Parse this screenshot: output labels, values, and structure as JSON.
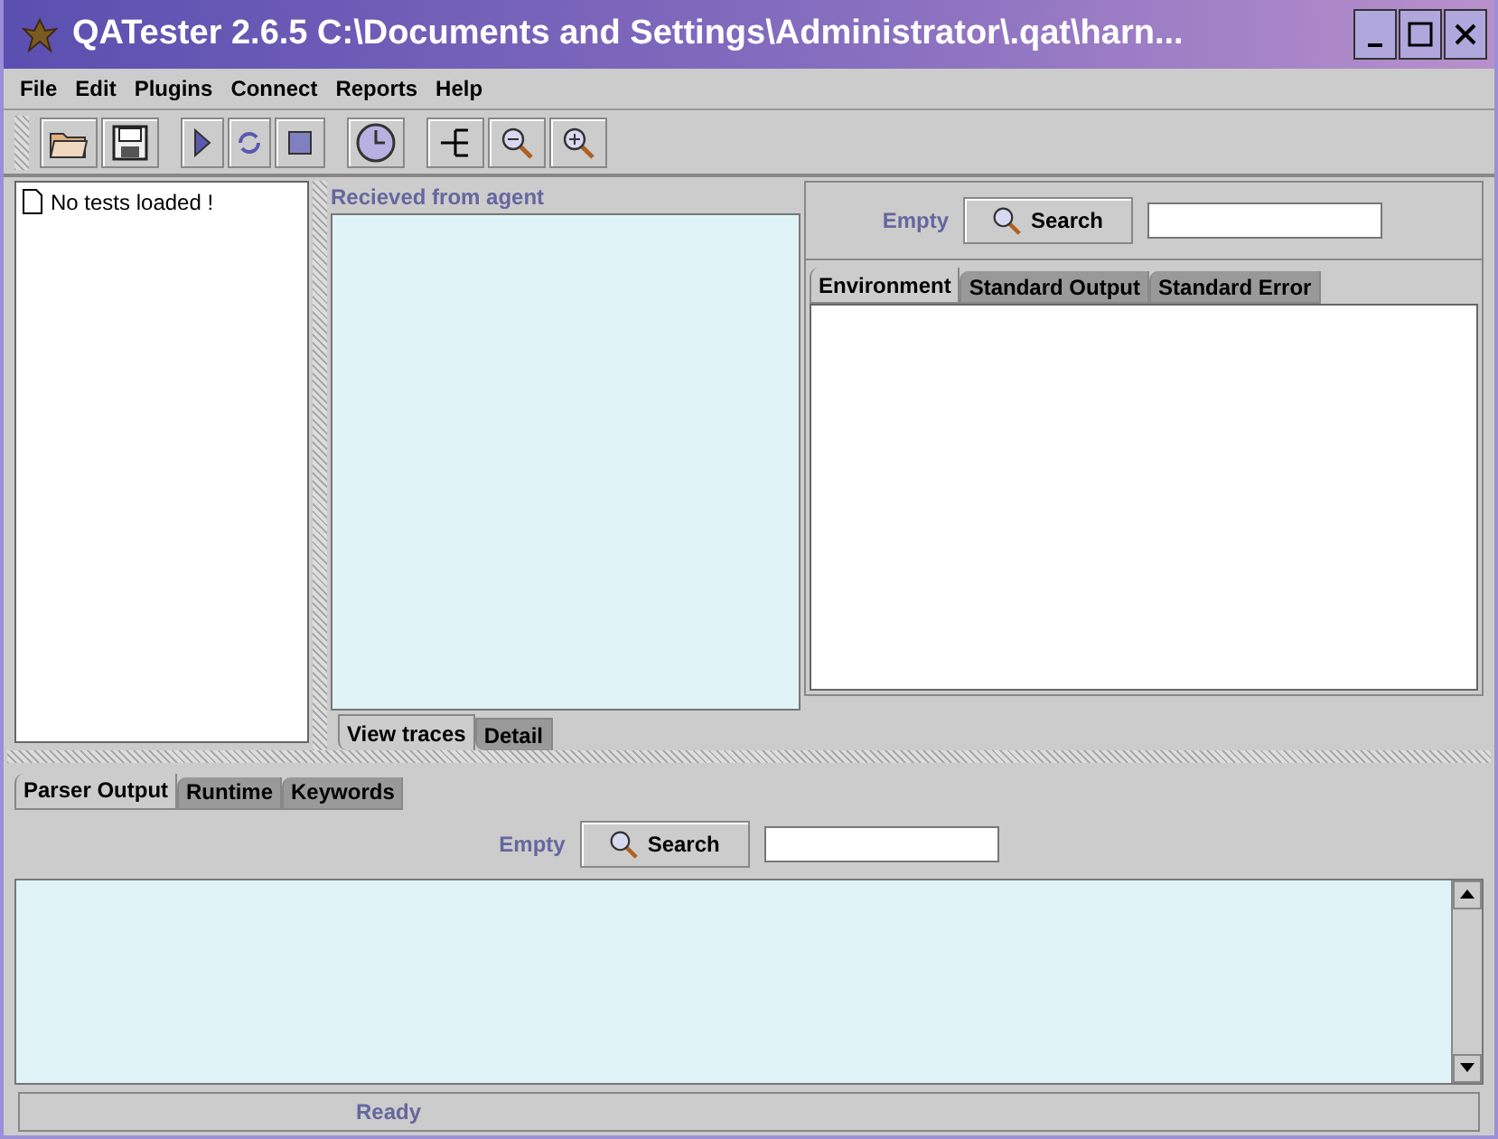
{
  "window": {
    "title": "QATester 2.6.5 C:\\Documents and Settings\\Administrator\\.qat\\harn..."
  },
  "menu": [
    "File",
    "Edit",
    "Plugins",
    "Connect",
    "Reports",
    "Help"
  ],
  "tree": {
    "items": [
      {
        "label": "No tests loaded !"
      }
    ]
  },
  "traces": {
    "heading": "Recieved from agent",
    "tabs": [
      {
        "label": "View traces",
        "selected": true
      },
      {
        "label": "Detail",
        "selected": false
      }
    ]
  },
  "details": {
    "search": {
      "status": "Empty",
      "button": "Search"
    },
    "tabs": [
      {
        "label": "Environment",
        "selected": true
      },
      {
        "label": "Standard Output",
        "selected": false
      },
      {
        "label": "Standard Error",
        "selected": false
      }
    ]
  },
  "output": {
    "tabs": [
      {
        "label": "Parser Output",
        "selected": true
      },
      {
        "label": "Runtime",
        "selected": false
      },
      {
        "label": "Keywords",
        "selected": false
      }
    ],
    "search": {
      "status": "Empty",
      "button": "Search"
    }
  },
  "status_bar": "Ready"
}
